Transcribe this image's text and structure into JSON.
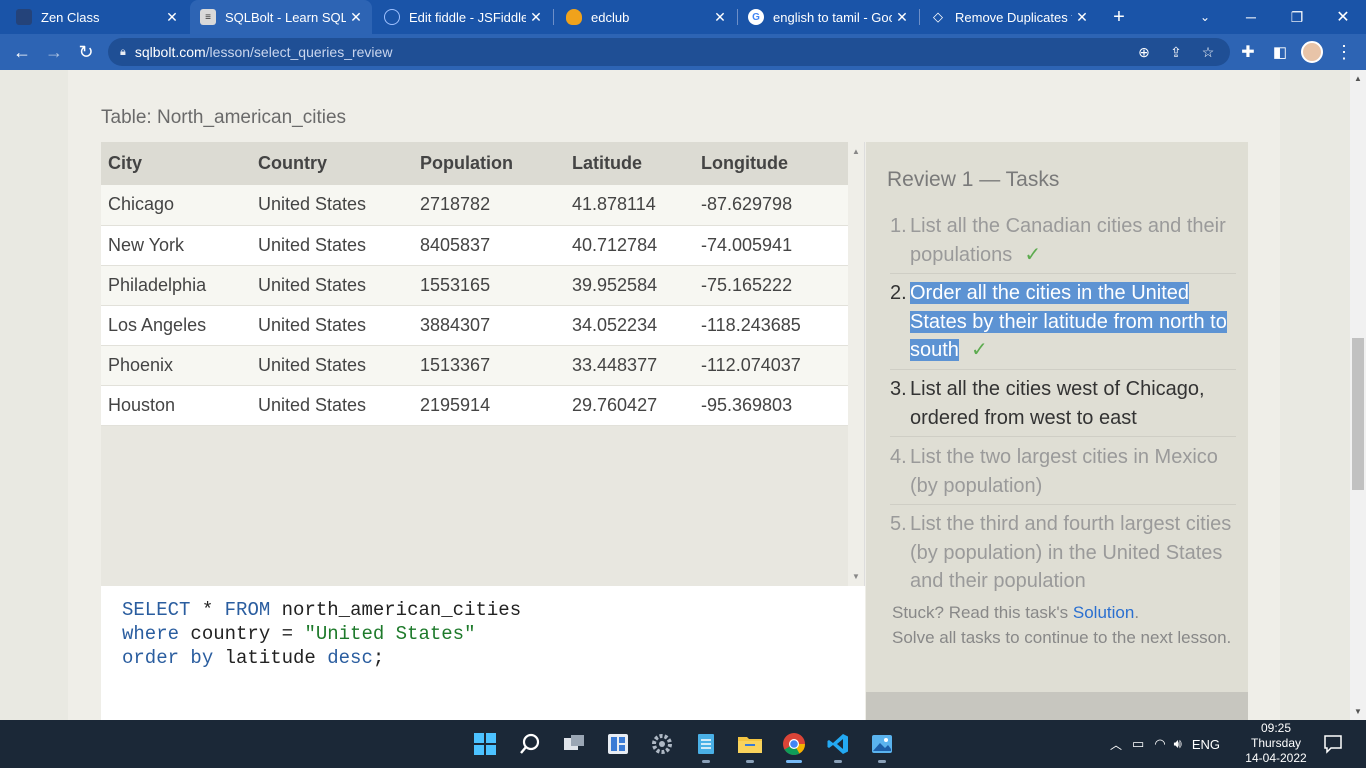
{
  "tabs": [
    {
      "title": "Zen Class",
      "icon": "zen-icon",
      "close": "✕"
    },
    {
      "title": "SQLBolt - Learn SQL -",
      "icon": "sqlbolt-icon",
      "close": "✕"
    },
    {
      "title": "Edit fiddle - JSFiddle -",
      "icon": "jsfiddle-icon",
      "close": "✕"
    },
    {
      "title": "edclub",
      "icon": "edclub-icon",
      "close": "✕"
    },
    {
      "title": "english to tamil - Goo",
      "icon": "google-icon",
      "close": "✕"
    },
    {
      "title": "Remove Duplicates fro",
      "icon": "remove-duplicates-icon",
      "close": "✕"
    }
  ],
  "new_tab_label": "+",
  "address": {
    "host": "sqlbolt.com",
    "path": "/lesson/select_queries_review"
  },
  "table_title": "Table: North_american_cities",
  "table": {
    "headers": [
      "City",
      "Country",
      "Population",
      "Latitude",
      "Longitude"
    ],
    "rows": [
      [
        "Chicago",
        "United States",
        "2718782",
        "41.878114",
        "-87.629798"
      ],
      [
        "New York",
        "United States",
        "8405837",
        "40.712784",
        "-74.005941"
      ],
      [
        "Philadelphia",
        "United States",
        "1553165",
        "39.952584",
        "-75.165222"
      ],
      [
        "Los Angeles",
        "United States",
        "3884307",
        "34.052234",
        "-118.243685"
      ],
      [
        "Phoenix",
        "United States",
        "1513367",
        "33.448377",
        "-112.074037"
      ],
      [
        "Houston",
        "United States",
        "2195914",
        "29.760427",
        "-95.369803"
      ]
    ]
  },
  "query": {
    "l1_kw1": "SELECT",
    "l1_star": " * ",
    "l1_kw2": "FROM",
    "l1_rest": " north_american_cities",
    "l2_kw": "where",
    "l2_rest": " country = ",
    "l2_str": "\"United States\"",
    "l3_kw1": "order by",
    "l3_mid": " latitude ",
    "l3_kw2": "desc",
    "l3_end": ";"
  },
  "review": {
    "title": "Review 1 — Tasks",
    "check": "✓",
    "tasks": [
      {
        "num": "1.",
        "text": "List all the Canadian cities and their populations"
      },
      {
        "num": "2.",
        "text": "Order all the cities in the United States by their latitude from north to south"
      },
      {
        "num": "3.",
        "text": "List all the cities west of Chicago, ordered from west to east"
      },
      {
        "num": "4.",
        "text": "List the two largest cities in Mexico (by population)"
      },
      {
        "num": "5.",
        "text": "List the third and fourth largest cities (by population) in the United States and their population"
      }
    ],
    "stuck_text": "Stuck? Read this task's ",
    "solution_link": "Solution",
    "stuck_end": ".",
    "continue_text": "Solve all tasks to continue to the next lesson."
  },
  "tray": {
    "lang": "ENG",
    "time": "09:25",
    "day": "Thursday",
    "date": "14-04-2022"
  }
}
